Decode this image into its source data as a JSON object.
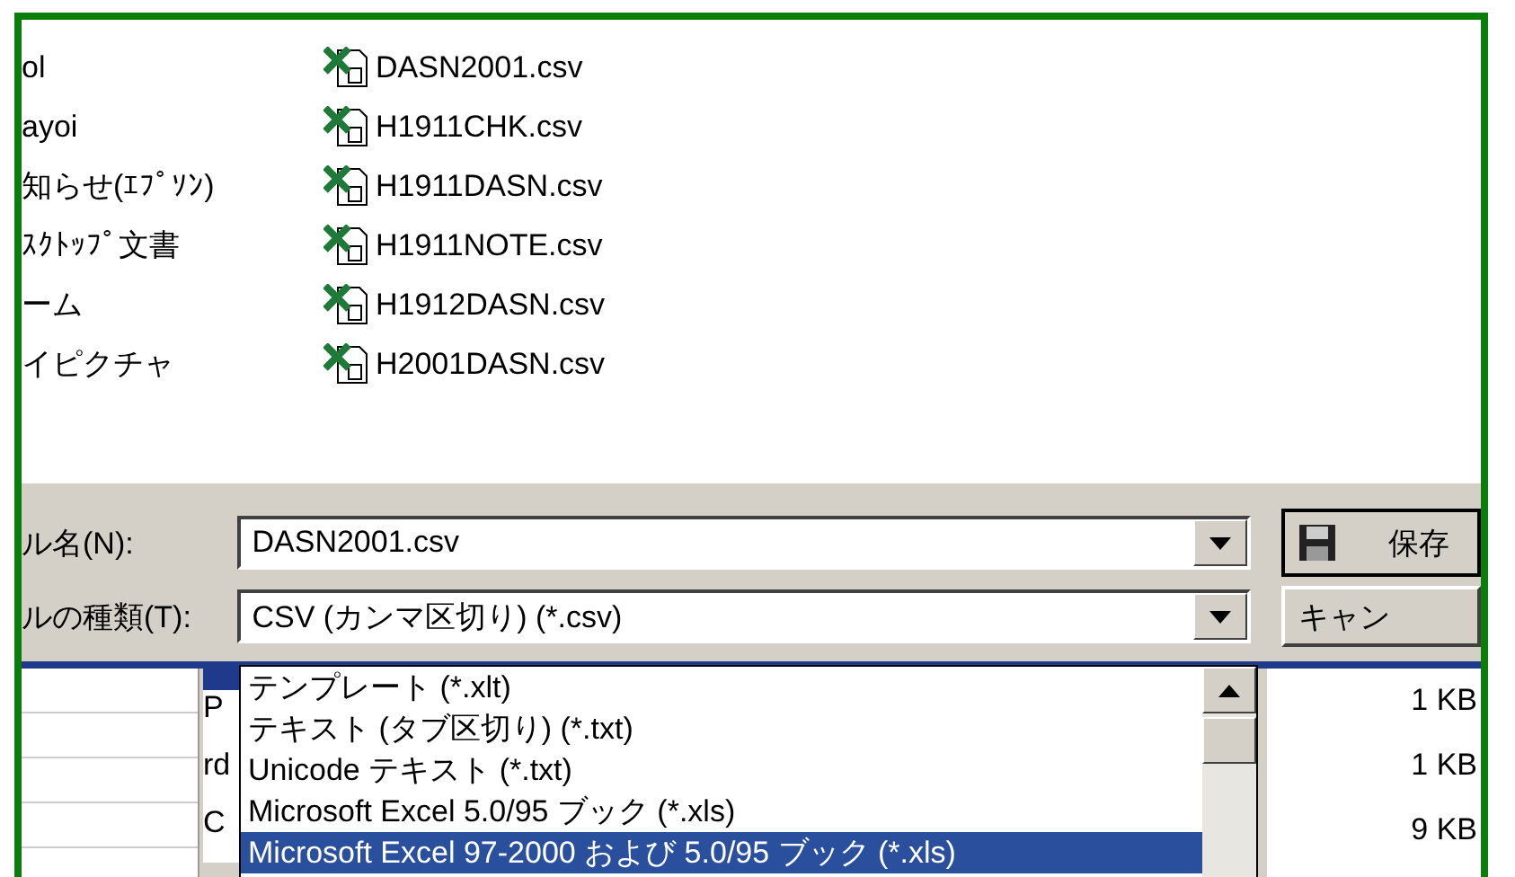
{
  "folders": [
    "ol",
    "ayoi",
    "知らせ(ｴﾌﾟｿﾝ)",
    "ｽｸﾄｯﾌﾟ文書",
    "ーム",
    "イピクチャ"
  ],
  "files": [
    "DASN2001.csv",
    "H1911CHK.csv",
    "H1911DASN.csv",
    "H1911NOTE.csv",
    "H1912DASN.csv",
    "H2001DASN.csv"
  ],
  "file_name": {
    "label": "ル名(N):",
    "value": "DASN2001.csv"
  },
  "save_button": "保存",
  "file_type": {
    "label": "ルの種類(T):",
    "value": "CSV (カンマ区切り) (*.csv)"
  },
  "cancel_button": "キャン",
  "type_options": [
    {
      "label": "テンプレート (*.xlt)",
      "selected": false
    },
    {
      "label": "テキスト (タブ区切り) (*.txt)",
      "selected": false
    },
    {
      "label": "Unicode テキスト (*.txt)",
      "selected": false
    },
    {
      "label": "Microsoft Excel 5.0/95 ブック (*.xls)",
      "selected": false
    },
    {
      "label": "Microsoft Excel 97-2000 および 5.0/95 ブック (*.xls)",
      "selected": true
    }
  ],
  "behind_list": {
    "name_fragments": [
      "P",
      "rd",
      "C"
    ],
    "sizes": [
      "1 KB",
      "1 KB",
      "9 KB"
    ]
  }
}
